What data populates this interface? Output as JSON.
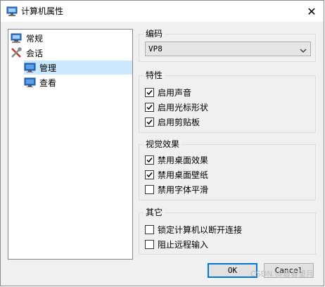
{
  "window": {
    "title": "计算机属性",
    "close_symbol": "✕"
  },
  "tree": {
    "items": [
      {
        "label": "常规",
        "icon": "computer-icon"
      },
      {
        "label": "会话",
        "icon": "tools-icon"
      },
      {
        "label": "管理",
        "icon": "monitor-icon",
        "selected": true
      },
      {
        "label": "查看",
        "icon": "monitor-icon"
      }
    ]
  },
  "encoding": {
    "group_label": "编码",
    "selected": "VP8"
  },
  "features": {
    "group_label": "特性",
    "items": [
      {
        "label": "启用声音",
        "checked": true
      },
      {
        "label": "启用光标形状",
        "checked": true
      },
      {
        "label": "启用剪贴板",
        "checked": true
      }
    ]
  },
  "visual": {
    "group_label": "视觉效果",
    "items": [
      {
        "label": "禁用桌面效果",
        "checked": true
      },
      {
        "label": "禁用桌面壁纸",
        "checked": true
      },
      {
        "label": "禁用字体平滑",
        "checked": false
      }
    ]
  },
  "other": {
    "group_label": "其它",
    "items": [
      {
        "label": "锁定计算机以断开连接",
        "checked": false
      },
      {
        "label": "阻止远程输入",
        "checked": false
      }
    ]
  },
  "buttons": {
    "ok": "OK",
    "cancel": "Cancel"
  },
  "watermark": "CSDN @暮春望月",
  "colors": {
    "selection": "#cce8ff",
    "default_button_border": "#0078d7"
  }
}
